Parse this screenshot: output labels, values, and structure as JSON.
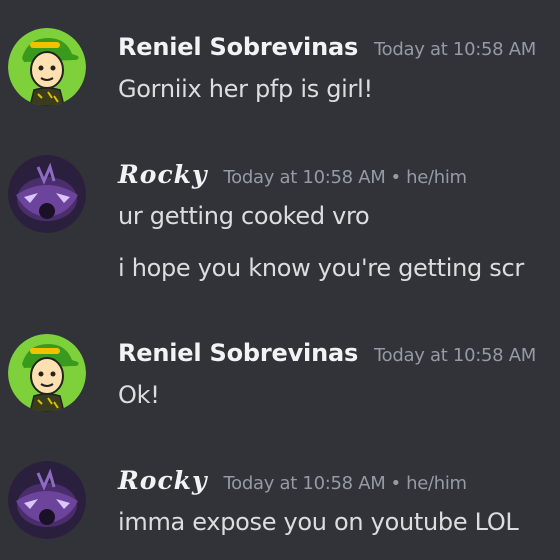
{
  "messages": [
    {
      "username": "Reniel Sobrevinas",
      "timestamp": "Today at 10:58 AM",
      "lines": [
        "Gorniix her pfp is girl!"
      ]
    },
    {
      "username": "Rocky",
      "timestamp": "Today at 10:58 AM",
      "separator": "•",
      "pronouns": "he/him",
      "lines": [
        "ur getting cooked vro",
        "i hope you know you're getting scr"
      ]
    },
    {
      "username": "Reniel Sobrevinas",
      "timestamp": "Today at 10:58 AM",
      "lines": [
        "Ok!"
      ]
    },
    {
      "username": "Rocky",
      "timestamp": "Today at 10:58 AM",
      "separator": "•",
      "pronouns": "he/him",
      "lines": [
        "imma expose you on youtube LOL"
      ]
    }
  ],
  "avatars": {
    "reniel": "cartoon-boy-green-cap-icon",
    "rocky": "dark-purple-creature-icon"
  },
  "colors": {
    "background": "#313338",
    "username": "#f2f3f5",
    "timestamp": "#949ba4",
    "message_text": "#dbdee1",
    "reniel_avatar_bg": "#7fd13b",
    "rocky_avatar_bg": "#2a1f3d"
  }
}
